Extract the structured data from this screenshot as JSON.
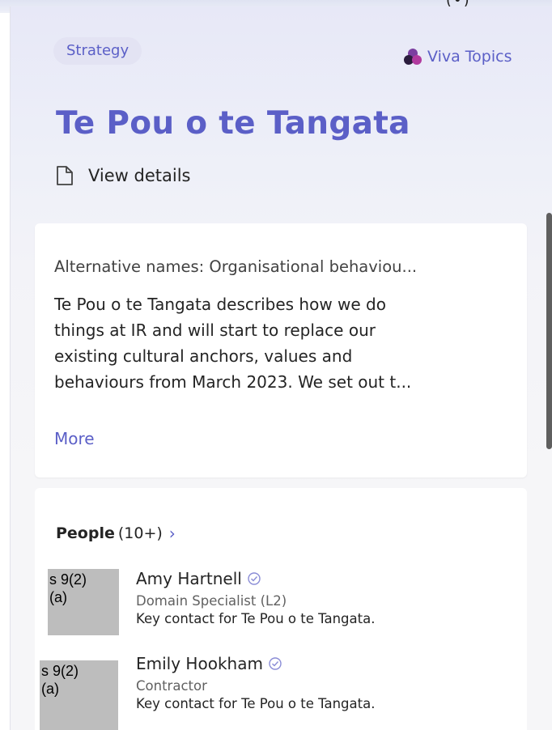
{
  "top_strip": {
    "clip_text": "(•)"
  },
  "topic": {
    "tag": "Strategy",
    "source": "Viva Topics",
    "title": "Te Pou o te Tangata",
    "view_details": "View details"
  },
  "description": {
    "alt_names": "Alternative names: Organisational behaviou...",
    "lines": [
      "Te Pou o te Tangata describes how we do",
      "things at IR and will start to replace our",
      "existing cultural anchors, values and",
      "behaviours from March 2023.  We set out t..."
    ],
    "more": "More"
  },
  "people": {
    "label": "People",
    "count": "(10+)",
    "chevron": "›",
    "items": [
      {
        "redaction": "s 9(2)\n(a)",
        "name": "Amy Hartnell",
        "role": "Domain Specialist (L2)",
        "note": "Key contact for Te Pou o te Tangata."
      },
      {
        "redaction": "s 9(2)\n(a)",
        "name": "Emily Hookham",
        "role": "Contractor",
        "note": "Key contact for Te Pou o te Tangata."
      }
    ]
  },
  "colors": {
    "accent": "#5b5fc7",
    "redaction": "#bdbdbd",
    "text": "#242424"
  }
}
